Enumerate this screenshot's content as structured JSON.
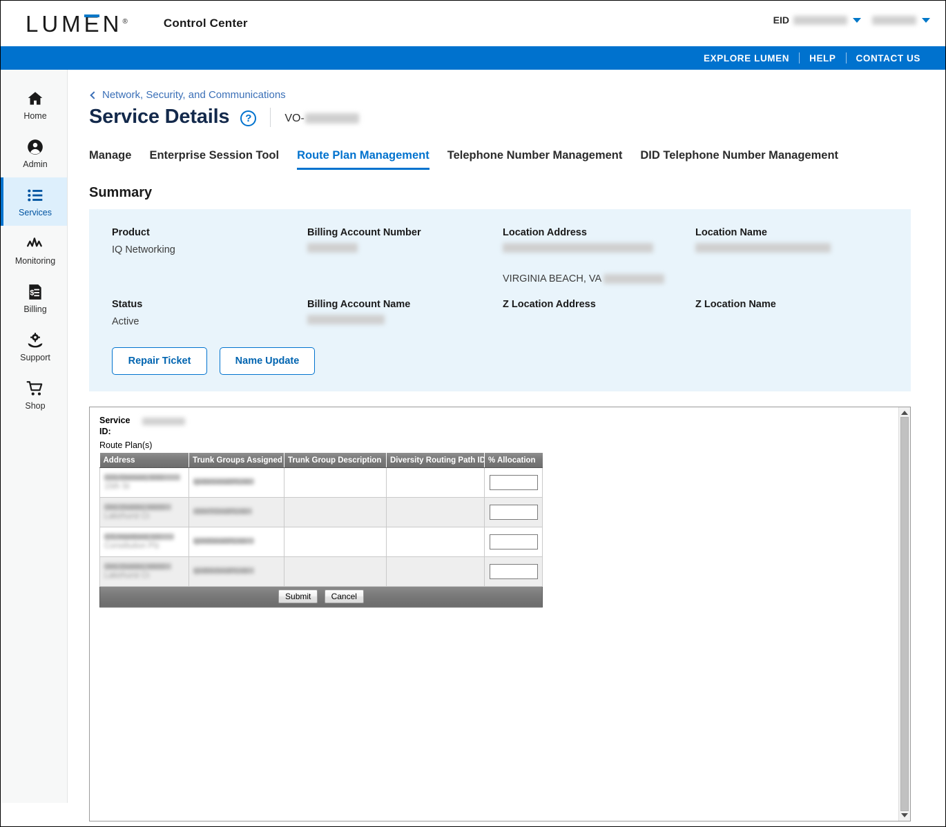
{
  "header": {
    "logo_text": "LUMEN",
    "logo_registered": "®",
    "app_title": "Control Center",
    "eid_label": "EID",
    "eid_value_redacted": "99842322",
    "user_value_redacted": "sqtrunk"
  },
  "bluebar": {
    "explore": "EXPLORE LUMEN",
    "help": "HELP",
    "contact": "CONTACT US"
  },
  "sidebar": {
    "items": [
      {
        "label": "Home",
        "icon": "home-icon"
      },
      {
        "label": "Admin",
        "icon": "user-circle-icon"
      },
      {
        "label": "Services",
        "icon": "list-icon"
      },
      {
        "label": "Monitoring",
        "icon": "activity-icon"
      },
      {
        "label": "Billing",
        "icon": "invoice-icon"
      },
      {
        "label": "Support",
        "icon": "gear-hand-icon"
      },
      {
        "label": "Shop",
        "icon": "cart-icon"
      }
    ],
    "active_index": 2
  },
  "page": {
    "breadcrumb": "Network, Security, and Communications",
    "title": "Service Details",
    "help_glyph": "?",
    "service_prefix": "VO-",
    "service_id_redacted": "500027944"
  },
  "tabs": [
    {
      "label": "Manage",
      "active": false
    },
    {
      "label": "Enterprise Session Tool",
      "active": false
    },
    {
      "label": "Route Plan Management",
      "active": true
    },
    {
      "label": "Telephone Number Management",
      "active": false
    },
    {
      "label": "DID Telephone Number Management",
      "active": false
    }
  ],
  "summary": {
    "section_title": "Summary",
    "fields": [
      {
        "label": "Product",
        "value": "IQ Networking",
        "redacted": false
      },
      {
        "label": "Billing Account Number",
        "value": "78382024",
        "redacted": true
      },
      {
        "label": "Location Address",
        "value_redacted_line1": "222 CENTRAL PARK AVE, FLR 16,",
        "value_visible_line2": "VIRGINIA BEACH, VA",
        "value_redacted_line2b": "23462, USA",
        "redacted": true
      },
      {
        "label": "Location Name",
        "value": "VIRGINIA BEACH - NORFOLK",
        "redacted": true
      },
      {
        "label": "Status",
        "value": "Active",
        "redacted": false
      },
      {
        "label": "Billing Account Name",
        "value": "APEX SYSTEMS",
        "redacted": true
      },
      {
        "label": "Z Location Address",
        "value": "",
        "redacted": false
      },
      {
        "label": "Z Location Name",
        "value": "",
        "redacted": false
      }
    ],
    "buttons": [
      {
        "label": "Repair Ticket"
      },
      {
        "label": "Name Update"
      }
    ]
  },
  "route_plan": {
    "service_id_label": "Service ID:",
    "service_id_redacted": "63869762",
    "route_plans_label": "Route Plan(s)",
    "columns": [
      "Address",
      "Trunk Groups Assigned",
      "Trunk Group Description",
      "Diversity Routing Path ID",
      "% Allocation"
    ],
    "rows": [
      {
        "address_redacted": "CO, Denver, 930 15th St",
        "trunk_group_redacted": "qvdenvealiPLnb",
        "description": "",
        "diversity_path_id": "",
        "allocation": ""
      },
      {
        "address_redacted": "OH, Dublin, 4600 Lakehurst Ct",
        "trunk_group_redacted": "cbhrTGndPLnb",
        "description": "",
        "diversity_path_id": "",
        "allocation": ""
      },
      {
        "address_redacted": "CT, Hartford, 10 Constitution Plz",
        "trunk_group_redacted": "qvhtfdealiPLnb",
        "description": "",
        "diversity_path_id": "",
        "allocation": ""
      },
      {
        "address_redacted": "OH, Dublin, 4600 Lakehurst Ct",
        "trunk_group_redacted": "qvdblcbndPLnb",
        "description": "",
        "diversity_path_id": "",
        "allocation": ""
      }
    ],
    "submit_label": "Submit",
    "cancel_label": "Cancel"
  },
  "colors": {
    "lumen_blue": "#0072ce",
    "navy": "#13294b",
    "panel_blue": "#e9f4fb",
    "link_blue": "#3a6fb7",
    "active_nav_bg": "#ddeffc"
  }
}
